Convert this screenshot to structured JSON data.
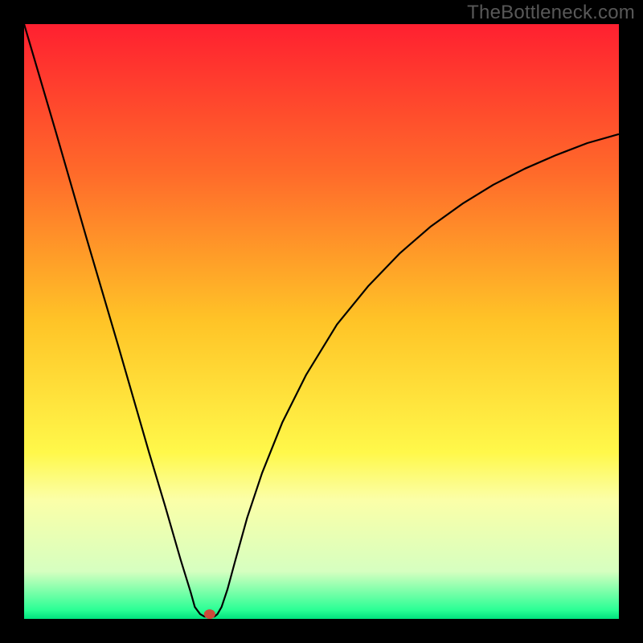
{
  "watermark": "TheBottleneck.com",
  "chart_data": {
    "type": "line",
    "title": "",
    "xlabel": "",
    "ylabel": "",
    "xlim": [
      0,
      100
    ],
    "ylim": [
      0,
      100
    ],
    "grid": false,
    "legend": false,
    "background_gradient": [
      {
        "stop": 0.0,
        "color": "#ff2030"
      },
      {
        "stop": 0.25,
        "color": "#ff6a2a"
      },
      {
        "stop": 0.5,
        "color": "#ffc427"
      },
      {
        "stop": 0.72,
        "color": "#fff84a"
      },
      {
        "stop": 0.8,
        "color": "#fbffa8"
      },
      {
        "stop": 0.92,
        "color": "#d6ffc0"
      },
      {
        "stop": 0.985,
        "color": "#2aff95"
      },
      {
        "stop": 1.0,
        "color": "#00e27e"
      }
    ],
    "series": [
      {
        "name": "bottleneck-curve",
        "x": [
          0.0,
          5.3,
          10.5,
          15.8,
          21.0,
          23.7,
          26.3,
          28.0,
          28.7,
          29.6,
          30.3,
          31.0,
          31.5,
          32.0,
          32.5,
          33.2,
          34.2,
          35.5,
          37.5,
          40.0,
          43.4,
          47.4,
          52.6,
          57.9,
          63.2,
          68.4,
          73.7,
          78.9,
          84.2,
          89.5,
          94.7,
          100.0
        ],
        "values": [
          100.0,
          82.0,
          64.0,
          46.0,
          28.0,
          19.0,
          10.0,
          4.5,
          2.0,
          0.8,
          0.4,
          0.3,
          0.3,
          0.4,
          0.8,
          2.0,
          5.0,
          9.8,
          17.0,
          24.5,
          33.0,
          41.0,
          49.5,
          56.0,
          61.5,
          66.0,
          69.8,
          73.0,
          75.7,
          78.0,
          80.0,
          81.5
        ]
      }
    ],
    "marker": {
      "name": "optimal-point",
      "x": 31.2,
      "y": 0.8,
      "color": "#cc4a3a",
      "rx": 7,
      "ry": 6
    }
  }
}
